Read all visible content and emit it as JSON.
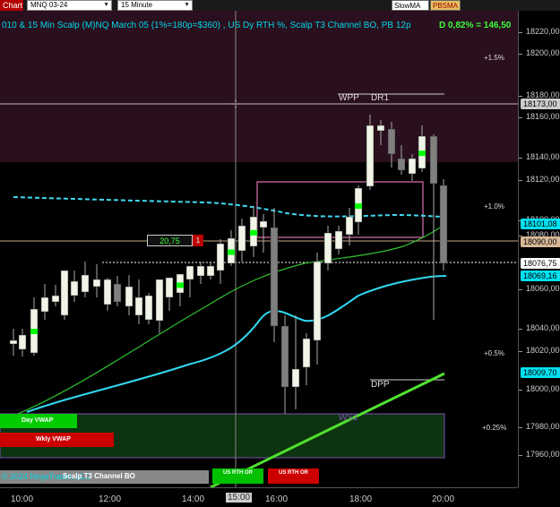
{
  "toolbar": {
    "tab": "Chart",
    "instrument": "MNQ 03-24",
    "interval": "15 Minute",
    "buttons": [
      "SlowMA",
      "PBSMA"
    ]
  },
  "title": "010 & 15 Min Scalp (M)NQ March 05 (1%=180p=$360) , US Dy RTH %, Scalp T3 Channel BO, PB 12p",
  "daily_change": "D 0,82% = 146,50",
  "price_axis": {
    "ticks": [
      "18220,00",
      "18200,00",
      "18180,00",
      "18160,00",
      "18140,00",
      "18120,00",
      "18100,00",
      "18080,00",
      "18060,00",
      "18040,00",
      "18020,00",
      "18000,00",
      "17980,00",
      "17960,00"
    ],
    "badges": [
      {
        "label": "18173,00",
        "bg": "#cccccc",
        "fg": "#000000"
      },
      {
        "label": "18101,08",
        "bg": "#00e0f0",
        "fg": "#000000"
      },
      {
        "label": "18090,00",
        "bg": "#d8b898",
        "fg": "#000000"
      },
      {
        "label": "18076,75",
        "bg": "#ffffff",
        "fg": "#000000"
      },
      {
        "label": "18069,16",
        "bg": "#00e0f0",
        "fg": "#000000"
      },
      {
        "label": "18009,70",
        "bg": "#00e0f0",
        "fg": "#000000"
      }
    ]
  },
  "time_axis": {
    "ticks": [
      "10:00",
      "12:00",
      "14:00",
      "15:00",
      "16:00",
      "18:00",
      "20:00"
    ],
    "highlight": "15:00"
  },
  "levels": {
    "wpp": "WPP",
    "dr1": "DR1",
    "dpp": "DPP",
    "ws1": "WS1",
    "pct": [
      "+1.5%",
      "+1.0%",
      "+0.5%",
      "+0.25%"
    ]
  },
  "position": {
    "pnl": "20,75",
    "qty": "1"
  },
  "bottom_panel": {
    "day_vwap": "Day VWAP",
    "wkly_vwap": "Wkly VWAP",
    "rth_or_1": "US RTH OR",
    "rth_or_2": "US RTH OR"
  },
  "footer": {
    "copyright": "© 2024 NinjaTrader, LLC",
    "strategy": "Scalp T3 Channel BO"
  },
  "colors": {
    "bull": "#f0f5e8",
    "bear": "#808080",
    "signal": "#00ff00",
    "vwap_dashed": "#40d8f0",
    "ema_cyan": "#30d8f0",
    "sma_green": "#30c030",
    "magenta_zone": "#2a0f1e",
    "box": "#e070b0"
  }
}
